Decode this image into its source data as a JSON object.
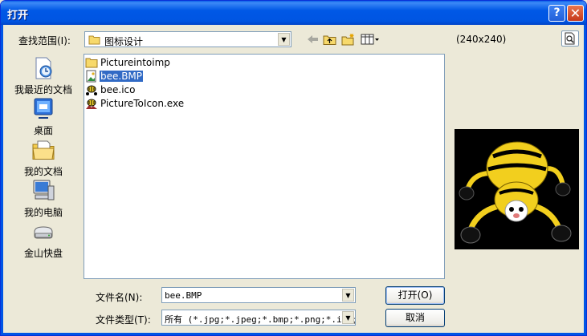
{
  "window": {
    "title": "打开",
    "help_glyph": "?",
    "close_glyph": "✕"
  },
  "lookin": {
    "label": "查找范围(I):",
    "value": "图标设计"
  },
  "preview": {
    "dims": "(240x240)"
  },
  "places": [
    {
      "label": "我最近的文档",
      "icon": "recent-documents-icon"
    },
    {
      "label": "桌面",
      "icon": "desktop-icon"
    },
    {
      "label": "我的文档",
      "icon": "my-documents-icon"
    },
    {
      "label": "我的电脑",
      "icon": "my-computer-icon"
    },
    {
      "label": "金山快盘",
      "icon": "drive-icon"
    }
  ],
  "files": [
    {
      "name": "Pictureintoimp",
      "icon": "folder-icon",
      "selected": false
    },
    {
      "name": "bee.BMP",
      "icon": "bitmap-file-icon",
      "selected": true
    },
    {
      "name": "bee.ico",
      "icon": "bee-ico-file-icon",
      "selected": false
    },
    {
      "name": "PictureToIcon.exe",
      "icon": "exe-file-icon",
      "selected": false
    }
  ],
  "filename": {
    "label": "文件名(N):",
    "value": "bee.BMP"
  },
  "filetype": {
    "label": "文件类型(T):",
    "value": "所有 (*.jpg;*.jpeg;*.bmp;*.png;*.ico;"
  },
  "buttons": {
    "open": "打开(O)",
    "cancel": "取消"
  },
  "colors": {
    "titlebar": "#0058e6",
    "selection": "#316ac5",
    "face": "#ece9d8"
  }
}
